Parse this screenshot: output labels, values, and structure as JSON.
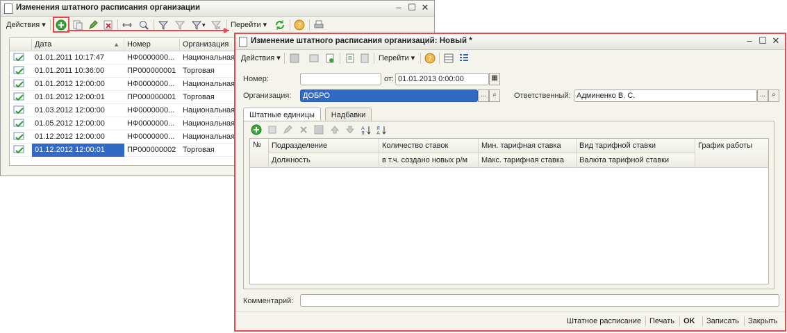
{
  "list_window": {
    "title": "Изменения штатного расписания организации",
    "toolbar": {
      "actions_label": "Действия",
      "goto_label": "Перейти"
    },
    "columns": [
      "Дата",
      "Номер",
      "Организация"
    ],
    "rows": [
      {
        "date": "01.01.2011 10:17:47",
        "number": "НФ0000000...",
        "org": "Национальная"
      },
      {
        "date": "01.01.2011 10:36:00",
        "number": "ПР000000001",
        "org": "Торговая"
      },
      {
        "date": "01.01.2012 12:00:00",
        "number": "НФ0000000...",
        "org": "Национальная"
      },
      {
        "date": "01.01.2012 12:00:01",
        "number": "ПР000000001",
        "org": "Торговая"
      },
      {
        "date": "01.03.2012 12:00:00",
        "number": "НФ0000000...",
        "org": "Национальная"
      },
      {
        "date": "01.05.2012 12:00:00",
        "number": "НФ0000000...",
        "org": "Национальная"
      },
      {
        "date": "01.12.2012 12:00:00",
        "number": "НФ0000000...",
        "org": "Национальная"
      },
      {
        "date": "01.12.2012 12:00:01",
        "number": "ПР000000002",
        "org": "Торговая"
      }
    ]
  },
  "form_window": {
    "title": "Изменение штатного расписания организаций: Новый *",
    "toolbar": {
      "actions_label": "Действия",
      "goto_label": "Перейти"
    },
    "fields": {
      "number_label": "Номер:",
      "number_value": "",
      "from_label": "от:",
      "date_value": "01.01.2013  0:00:00",
      "org_label": "Организация:",
      "org_value": "ДОБРО",
      "responsible_label": "Ответственный:",
      "responsible_value": "Админенко В. С.",
      "comment_label": "Комментарий:",
      "comment_value": ""
    },
    "tabs": [
      "Штатные единицы",
      "Надбавки"
    ],
    "grid_headers_row1": [
      "№",
      "Подразделение",
      "Количество ставок",
      "Мин. тарифная ставка",
      "Вид тарифной ставки",
      "График работы"
    ],
    "grid_headers_row2": [
      "Должность",
      "в т.ч. создано новых р/м",
      "Макс. тарифная ставка",
      "Валюта тарифной ставки"
    ],
    "footer_buttons": [
      "Штатное расписание",
      "Печать",
      "OK",
      "Записать",
      "Закрыть"
    ]
  },
  "colors": {
    "highlight": "#e8474c",
    "selection": "#316ac5",
    "add_green": "#3aa53a"
  }
}
